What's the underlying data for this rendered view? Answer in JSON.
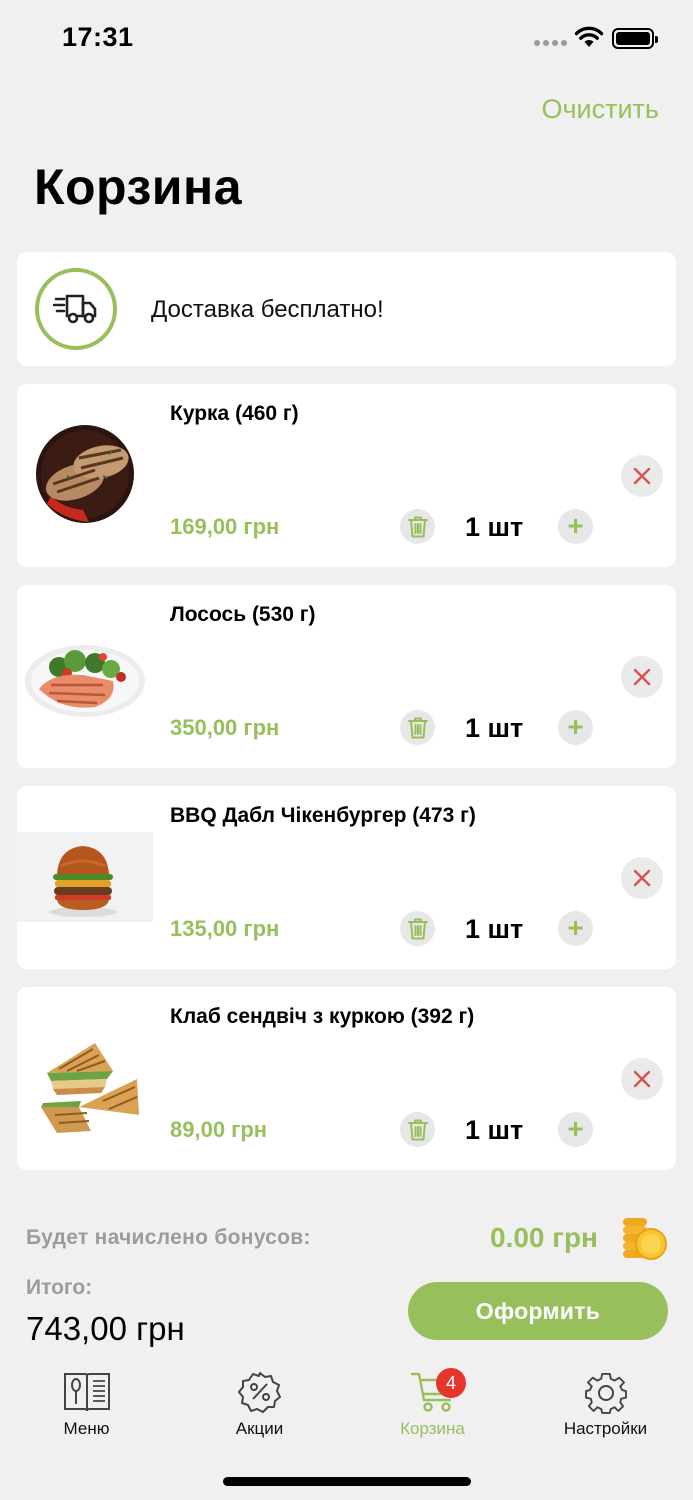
{
  "status_bar": {
    "time": "17:31"
  },
  "header": {
    "clear_label": "Очистить",
    "title": "Корзина"
  },
  "delivery": {
    "text": "Доставка бесплатно!"
  },
  "items": [
    {
      "name": "Курка (460 г)",
      "price": "169,00 грн",
      "qty": "1 шт"
    },
    {
      "name": "Лосось (530 г)",
      "price": "350,00 грн",
      "qty": "1 шт"
    },
    {
      "name": "BBQ Дабл Чікенбургер (473 г)",
      "price": "135,00 грн",
      "qty": "1 шт"
    },
    {
      "name": "Клаб сендвіч з куркою (392 г)",
      "price": "89,00 грн",
      "qty": "1 шт"
    }
  ],
  "summary": {
    "bonus_label": "Будет начислено бонусов:",
    "bonus_value": "0.00 грн",
    "total_label": "Итого:",
    "total_value": "743,00 грн",
    "checkout_label": "Оформить"
  },
  "tabs": [
    {
      "label": "Меню",
      "icon": "menu-book-icon"
    },
    {
      "label": "Акции",
      "icon": "discount-badge-icon"
    },
    {
      "label": "Корзина",
      "icon": "cart-icon",
      "active": true,
      "badge": "4"
    },
    {
      "label": "Настройки",
      "icon": "gear-icon"
    }
  ],
  "colors": {
    "accent": "#97c05c",
    "badge": "#e5352c",
    "background": "#f0f0f0",
    "remove": "#d9534f"
  }
}
